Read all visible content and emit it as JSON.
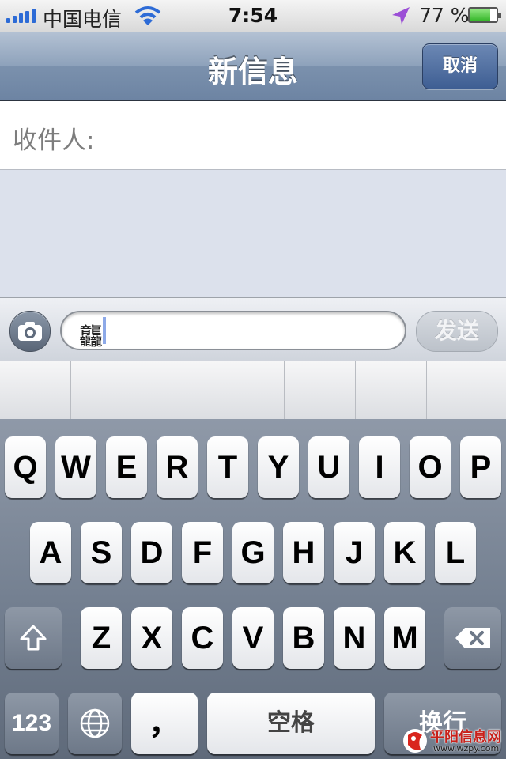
{
  "status_bar": {
    "carrier": "中国电信",
    "time": "7:54",
    "battery": "77 %",
    "battery_level": 0.77,
    "icons": [
      "signal-icon",
      "wifi-icon",
      "location-icon",
      "battery-icon"
    ]
  },
  "nav": {
    "title": "新信息",
    "cancel_label": "取消"
  },
  "recipient": {
    "label": "收件人:"
  },
  "compose": {
    "text": "龘",
    "send_label": "发送",
    "camera_icon": "camera-icon"
  },
  "keyboard": {
    "row1": [
      "Q",
      "W",
      "E",
      "R",
      "T",
      "Y",
      "U",
      "I",
      "O",
      "P"
    ],
    "row2": [
      "A",
      "S",
      "D",
      "F",
      "G",
      "H",
      "J",
      "K",
      "L"
    ],
    "row3": [
      "Z",
      "X",
      "C",
      "V",
      "B",
      "N",
      "M"
    ],
    "shift_icon": "shift-icon",
    "backspace_icon": "backspace-icon",
    "numbers_label": "123",
    "globe_icon": "globe-icon",
    "comma_label": "，",
    "space_label": "空格",
    "return_label": "换行"
  },
  "watermark": {
    "brand": "平阳信息网",
    "url": "www.wzpy.com"
  },
  "colors": {
    "nav_blue": "#7b91ad",
    "accent_blue": "#2d6bd6",
    "location_purple": "#9b4fd6",
    "battery_green": "#47c83e"
  }
}
